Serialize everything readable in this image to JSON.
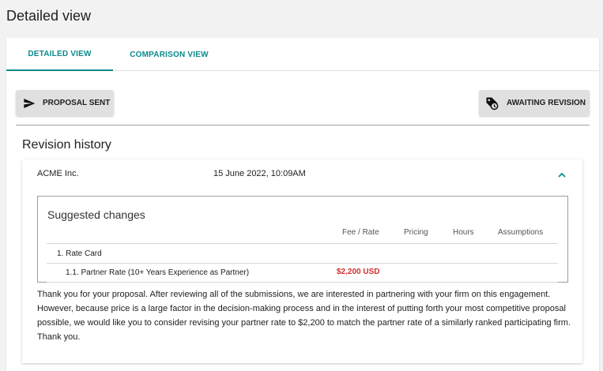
{
  "page": {
    "title": "Detailed view"
  },
  "tabs": [
    {
      "label": "DETAILED VIEW",
      "active": true
    },
    {
      "label": "COMPARISON VIEW",
      "active": false
    }
  ],
  "status": {
    "left": {
      "label": "PROPOSAL SENT",
      "icon": "send-icon"
    },
    "right": {
      "label": "AWAITING REVISION",
      "icon": "tag-icon"
    }
  },
  "revision_history": {
    "title": "Revision history",
    "entries": [
      {
        "company": "ACME Inc.",
        "date": "15 June 2022, 10:09AM",
        "expanded": true,
        "suggested_changes": {
          "title": "Suggested changes",
          "columns": [
            "Fee / Rate",
            "Pricing",
            "Hours",
            "Assumptions"
          ],
          "rows": [
            {
              "label": "1. Rate Card",
              "fee": ""
            },
            {
              "label": "1.1. Partner Rate (10+ Years Experience as Partner)",
              "fee": "$2,200 USD"
            }
          ]
        },
        "message": "Thank you for your proposal. After reviewing all of the submissions, we are interested in partnering with your firm on this engagement.  However, because price is a large factor in the decision-making process and in the interest of putting forth your most competitive proposal possible, we would like you to consider revising your partner rate to $2,200 to match the partner rate of a similarly ranked participating firm. Thank you."
      }
    ]
  },
  "colors": {
    "accent": "#0a8a8a",
    "highlight": "#d32f2f"
  }
}
